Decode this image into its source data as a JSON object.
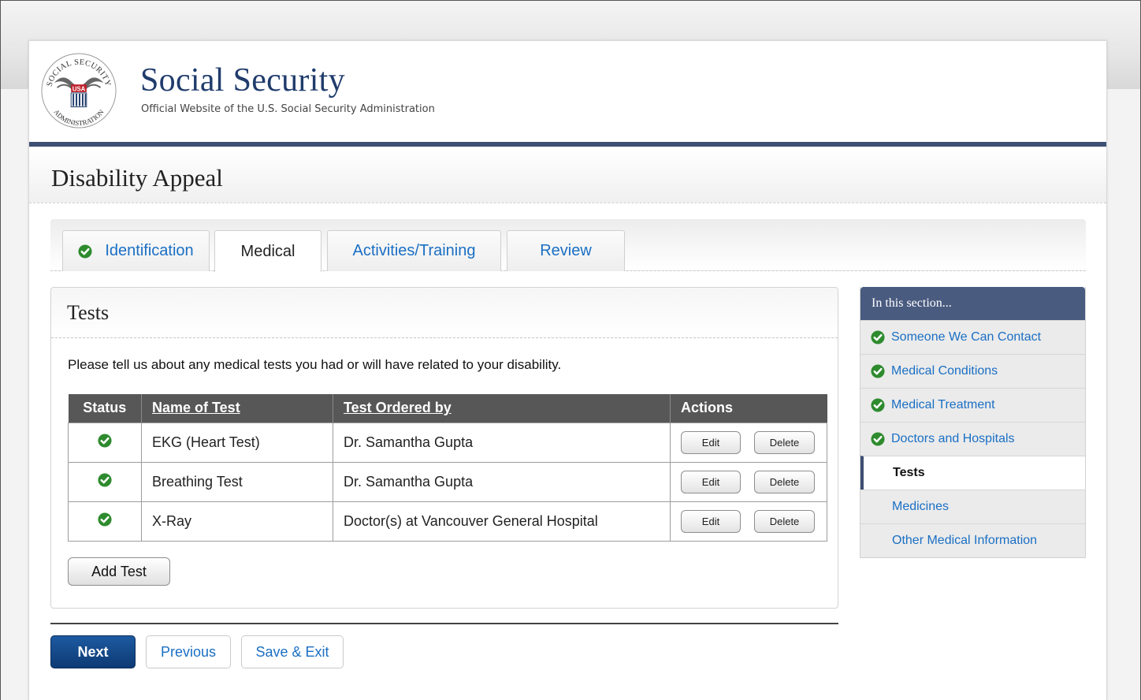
{
  "site": {
    "title": "Social Security",
    "subtitle": "Official Website of the U.S. Social Security Administration",
    "seal_text_top": "SOCIAL SECURITY",
    "seal_text_bottom": "ADMINISTRATION",
    "seal_usa": "USA"
  },
  "page_title": "Disability Appeal",
  "tabs": [
    {
      "label": "Identification",
      "completed": true
    },
    {
      "label": "Medical",
      "active": true
    },
    {
      "label": "Activities/Training"
    },
    {
      "label": "Review"
    }
  ],
  "tests_panel": {
    "title": "Tests",
    "intro": "Please tell us about any medical tests you had or will have related to your disability.",
    "columns": [
      "Status",
      "Name of Test",
      "Test Ordered by",
      "Actions"
    ],
    "rows": [
      {
        "name": "EKG (Heart Test)",
        "ordered_by": "Dr. Samantha Gupta",
        "status": "complete"
      },
      {
        "name": "Breathing Test",
        "ordered_by": "Dr. Samantha Gupta",
        "status": "complete"
      },
      {
        "name": "X-Ray",
        "ordered_by": "Doctor(s) at Vancouver General Hospital",
        "status": "complete"
      }
    ],
    "edit_label": "Edit",
    "delete_label": "Delete",
    "add_label": "Add Test"
  },
  "nav_buttons": {
    "next": "Next",
    "previous": "Previous",
    "save_exit": "Save & Exit"
  },
  "sidenav": {
    "heading": "In this section...",
    "items": [
      {
        "label": "Someone We Can Contact",
        "completed": true
      },
      {
        "label": "Medical Conditions",
        "completed": true
      },
      {
        "label": "Medical Treatment",
        "completed": true
      },
      {
        "label": "Doctors and Hospitals",
        "completed": true
      },
      {
        "label": "Tests",
        "current": true
      },
      {
        "label": "Medicines"
      },
      {
        "label": "Other Medical Information"
      }
    ]
  },
  "colors": {
    "brand_navy": "#203c6c",
    "header_bar": "#3d4f72",
    "link_blue": "#1a6fc4",
    "check_green": "#2e8b2e",
    "next_button": "#0d3a74"
  }
}
